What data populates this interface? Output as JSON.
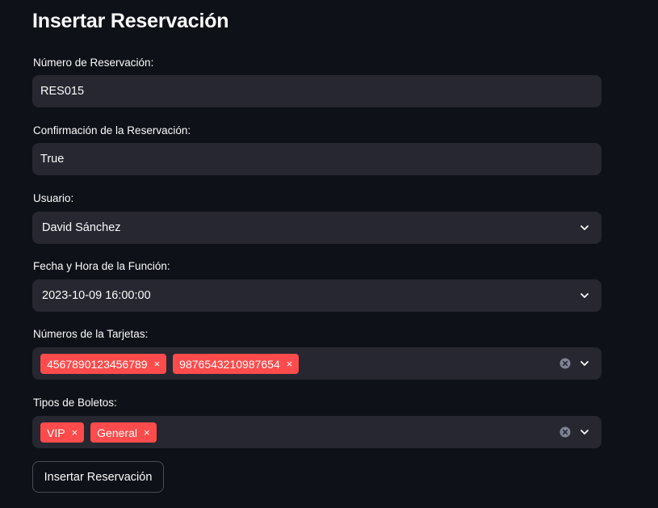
{
  "page": {
    "title": "Insertar Reservación"
  },
  "form": {
    "reservation_number": {
      "label": "Número de Reservación:",
      "value": "RES015"
    },
    "confirmation": {
      "label": "Confirmación de la Reservación:",
      "value": "True"
    },
    "user": {
      "label": "Usuario:",
      "value": "David Sánchez",
      "icon": "chevron-down-icon"
    },
    "showtime": {
      "label": "Fecha y Hora de la Función:",
      "value": "2023-10-09 16:00:00",
      "icon": "chevron-down-icon"
    },
    "cards": {
      "label": "Números de la Tarjetas:",
      "tags": [
        "4567890123456789",
        "9876543210987654"
      ],
      "remove_glyph": "×"
    },
    "ticket_types": {
      "label": "Tipos de Boletos:",
      "tags": [
        "VIP",
        "General"
      ],
      "remove_glyph": "×"
    },
    "submit_label": "Insertar Reservación"
  },
  "colors": {
    "background": "#0e1117",
    "field": "#262730",
    "tag": "#ff4b4b",
    "text": "#fafafa"
  }
}
